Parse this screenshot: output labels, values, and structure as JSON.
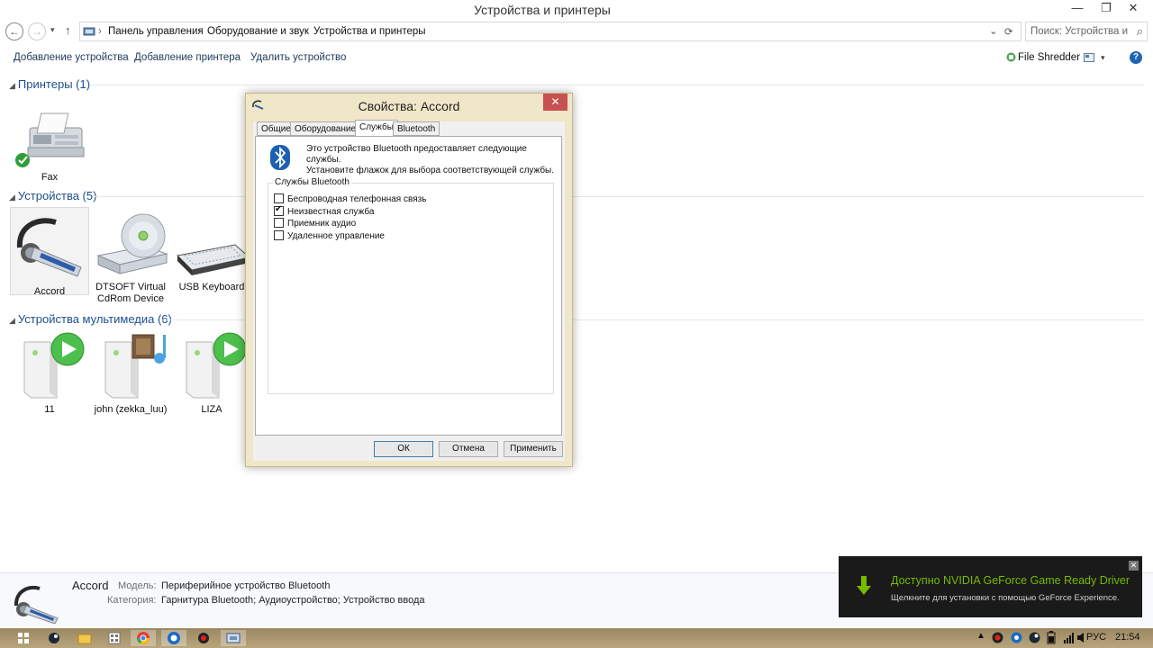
{
  "window": {
    "title": "Устройства и принтеры",
    "minimize": "—",
    "maximize": "❐",
    "close": "✕"
  },
  "address": {
    "back": "←",
    "forward": "→",
    "recent": "▾",
    "up": "↑",
    "crumbs": [
      "Панель управления",
      "Оборудование и звук",
      "Устройства и принтеры"
    ],
    "separator": "›",
    "dropdown": "⌄",
    "refresh": "⟳",
    "search_placeholder": "Поиск: Устройства и ...",
    "search_icon": "⌕"
  },
  "commands": {
    "add_device": "Добавление устройства",
    "add_printer": "Добавление принтера",
    "remove_device": "Удалить устройство",
    "file_shredder": "File Shredder",
    "view_dropdown": "▾",
    "help": "?"
  },
  "groups": {
    "printers": {
      "header": "Принтеры (1)",
      "items": [
        {
          "label": "Fax"
        }
      ]
    },
    "devices": {
      "header": "Устройства (5)",
      "items": [
        {
          "label": "Accord"
        },
        {
          "label": "DTSOFT Virtual CdRom Device"
        },
        {
          "label": "USB Keyboard"
        }
      ]
    },
    "multimedia": {
      "header": "Устройства мультимедиа (6)",
      "items": [
        {
          "label": "11"
        },
        {
          "label": "john (zekka_luu)"
        },
        {
          "label": "LIZA"
        }
      ]
    },
    "collapse_arrow": "◢"
  },
  "dialog": {
    "title": "Свойства: Accord",
    "close": "✕",
    "tabs": [
      "Общие",
      "Оборудование",
      "Службы",
      "Bluetooth"
    ],
    "active_tab": "Службы",
    "description_line1": "Это устройство Bluetooth предоставляет следующие службы.",
    "description_line2": "Установите флажок для выбора соответствующей службы.",
    "services_legend": "Службы Bluetooth",
    "services": [
      {
        "label": "Беспроводная телефонная связь",
        "checked": false
      },
      {
        "label": "Неизвестная служба",
        "checked": true
      },
      {
        "label": "Приемник аудио",
        "checked": false
      },
      {
        "label": "Удаленное управление",
        "checked": false
      }
    ],
    "ok": "ОК",
    "cancel": "Отмена",
    "apply": "Применить"
  },
  "details": {
    "name": "Accord",
    "model_key": "Модель:",
    "model_value": "Периферийное устройство Bluetooth",
    "category_key": "Категория:",
    "category_value": "Гарнитура Bluetooth; Аудиоустройство; Устройство ввода"
  },
  "toast": {
    "title": "Доступно NVIDIA GeForce Game Ready Driver",
    "subtitle": "Щелкните для установки с помощью GeForce Experience.",
    "close": "✕"
  },
  "taskbar": {
    "language": "РУС",
    "time": "21:54"
  },
  "colors": {
    "link": "#1e395b",
    "group_header": "#1e4e8c",
    "dialog_frame": "#f0e6c8",
    "nvidia_green": "#76b900"
  }
}
